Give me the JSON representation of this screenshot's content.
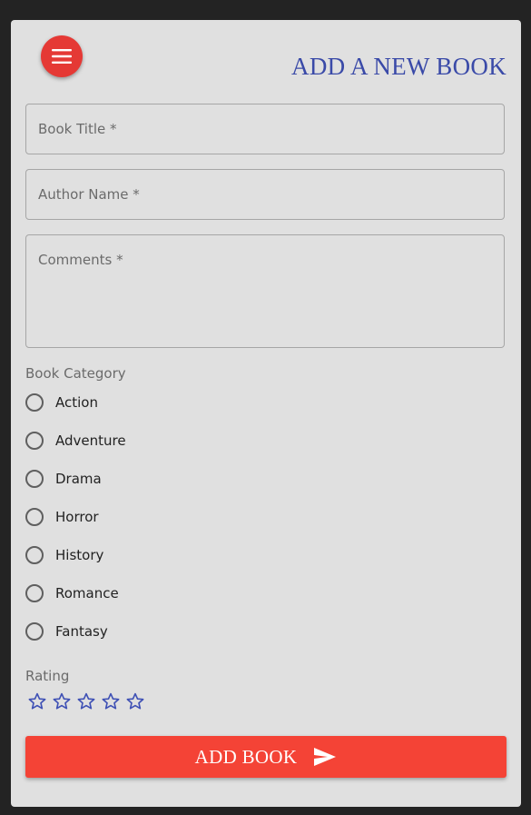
{
  "header": {
    "title": "ADD A NEW BOOK",
    "menu_icon": "menu-icon"
  },
  "form": {
    "book_title": {
      "placeholder": "Book Title *",
      "value": ""
    },
    "author_name": {
      "placeholder": "Author Name *",
      "value": ""
    },
    "comments": {
      "placeholder": "Comments *",
      "value": ""
    },
    "category": {
      "label": "Book Category",
      "options": [
        "Action",
        "Adventure",
        "Drama",
        "Horror",
        "History",
        "Romance",
        "Fantasy"
      ],
      "selected": null
    },
    "rating": {
      "label": "Rating",
      "max": 5,
      "value": 0,
      "icon": "star-outline-icon"
    },
    "submit": {
      "label": "ADD BOOK",
      "icon": "send-icon"
    }
  },
  "colors": {
    "page_background": "#232323",
    "card_background": "#e0e0e0",
    "accent_red": "#f44336",
    "menu_red": "#e53935",
    "title_blue": "#3a4aa8",
    "star_blue": "#3f51b5"
  }
}
